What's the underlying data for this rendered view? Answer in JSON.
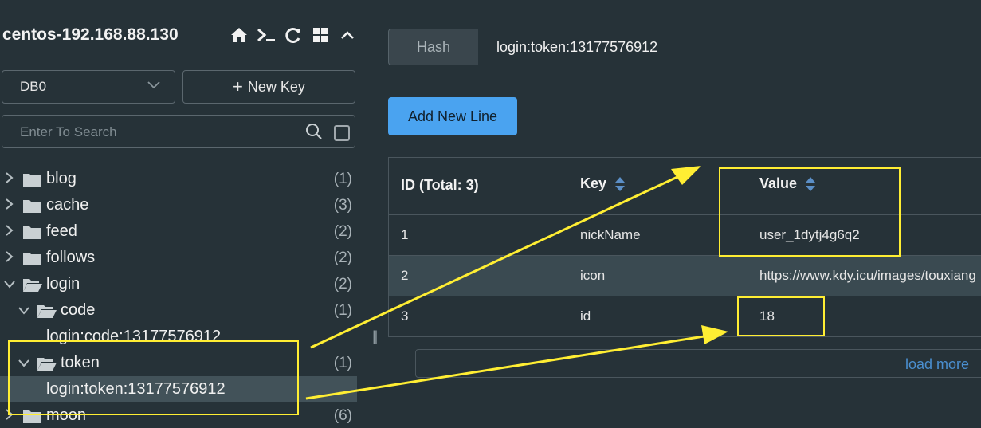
{
  "sidebar": {
    "connection_title": "centos-192.168.88.130",
    "toolbar_icons": [
      "home-icon",
      "terminal-icon",
      "refresh-icon",
      "grid-icon",
      "chevron-up-icon"
    ],
    "db_select": "DB0",
    "new_key_label": "New Key",
    "search_placeholder": "Enter To Search",
    "tree": [
      {
        "label": "blog",
        "count": "(1)",
        "expanded": false,
        "type": "folder"
      },
      {
        "label": "cache",
        "count": "(3)",
        "expanded": false,
        "type": "folder"
      },
      {
        "label": "feed",
        "count": "(2)",
        "expanded": false,
        "type": "folder"
      },
      {
        "label": "follows",
        "count": "(2)",
        "expanded": false,
        "type": "folder"
      },
      {
        "label": "login",
        "count": "(2)",
        "expanded": true,
        "type": "folder"
      },
      {
        "label": "code",
        "count": "(1)",
        "expanded": true,
        "type": "folder"
      },
      {
        "label": "login:code:13177576912",
        "count": "",
        "type": "key"
      },
      {
        "label": "token",
        "count": "(1)",
        "expanded": true,
        "type": "folder"
      },
      {
        "label": "login:token:13177576912",
        "count": "",
        "type": "key",
        "selected": true
      },
      {
        "label": "moon",
        "count": "(6)",
        "expanded": false,
        "type": "folder"
      }
    ]
  },
  "main": {
    "key_type": "Hash",
    "key_name": "login:token:13177576912",
    "add_line_label": "Add New Line",
    "columns": [
      "ID (Total: 3)",
      "Key",
      "Value"
    ],
    "rows": [
      {
        "id": "1",
        "key": "nickName",
        "value": "user_1dytj4g6q2"
      },
      {
        "id": "2",
        "key": "icon",
        "value": "https://www.kdy.icu/images/touxiang"
      },
      {
        "id": "3",
        "key": "id",
        "value": "18"
      }
    ],
    "load_more_label": "load more"
  },
  "colors": {
    "background": "#263238",
    "accent": "#4aa3f0",
    "annotation": "#ffee33",
    "selected_row": "#425259"
  }
}
